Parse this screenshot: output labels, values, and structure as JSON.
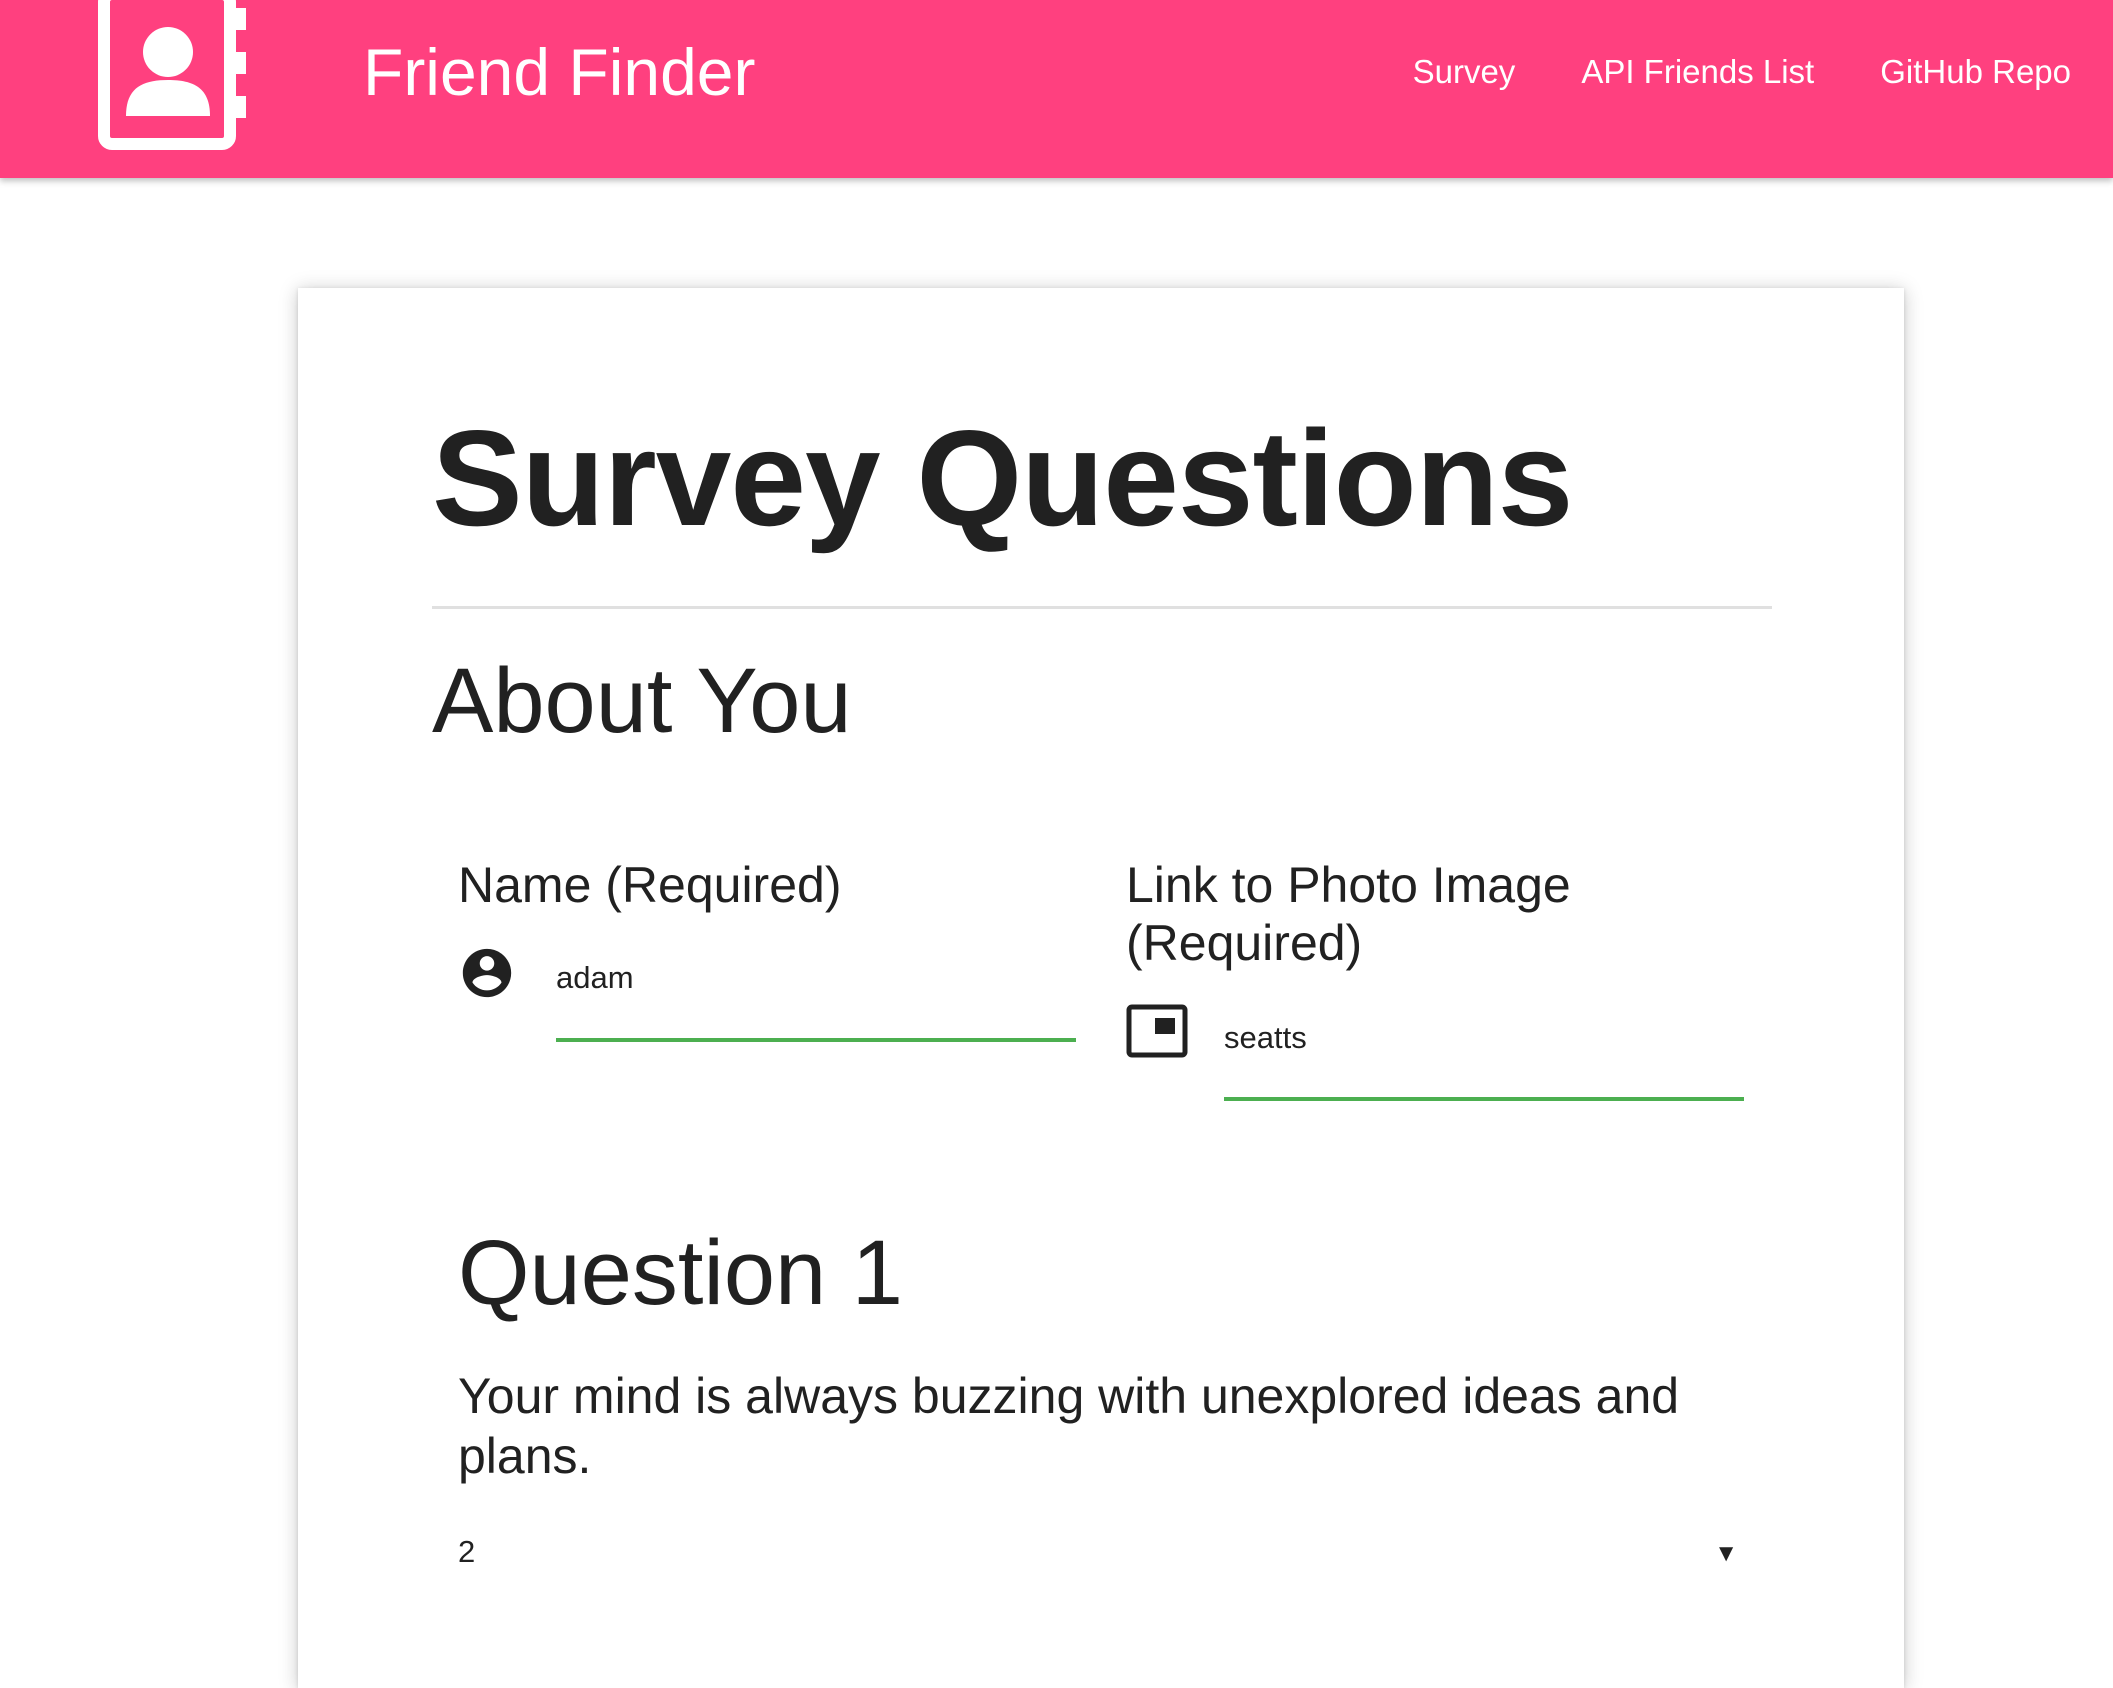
{
  "navbar": {
    "brand_title": "Friend Finder",
    "logo_icon": "contact-book-icon",
    "links": [
      {
        "label": "Survey"
      },
      {
        "label": "API Friends List"
      },
      {
        "label": "GitHub Repo"
      }
    ],
    "background_color": "#ff407f"
  },
  "card": {
    "title": "Survey Questions",
    "section_heading": "About You",
    "name_field": {
      "label": "Name (Required)",
      "icon": "account-circle-icon",
      "value": "adam"
    },
    "photo_field": {
      "label_line1": "Link to Photo Image",
      "label_line2": "(Required)",
      "icon": "picture-in-picture-icon",
      "value": "seatts"
    },
    "valid_color": "#4caf50",
    "question": {
      "heading": "Question 1",
      "text": "Your mind is always buzzing with unexplored ideas and plans.",
      "selected_value": "2",
      "caret": "▼"
    }
  }
}
